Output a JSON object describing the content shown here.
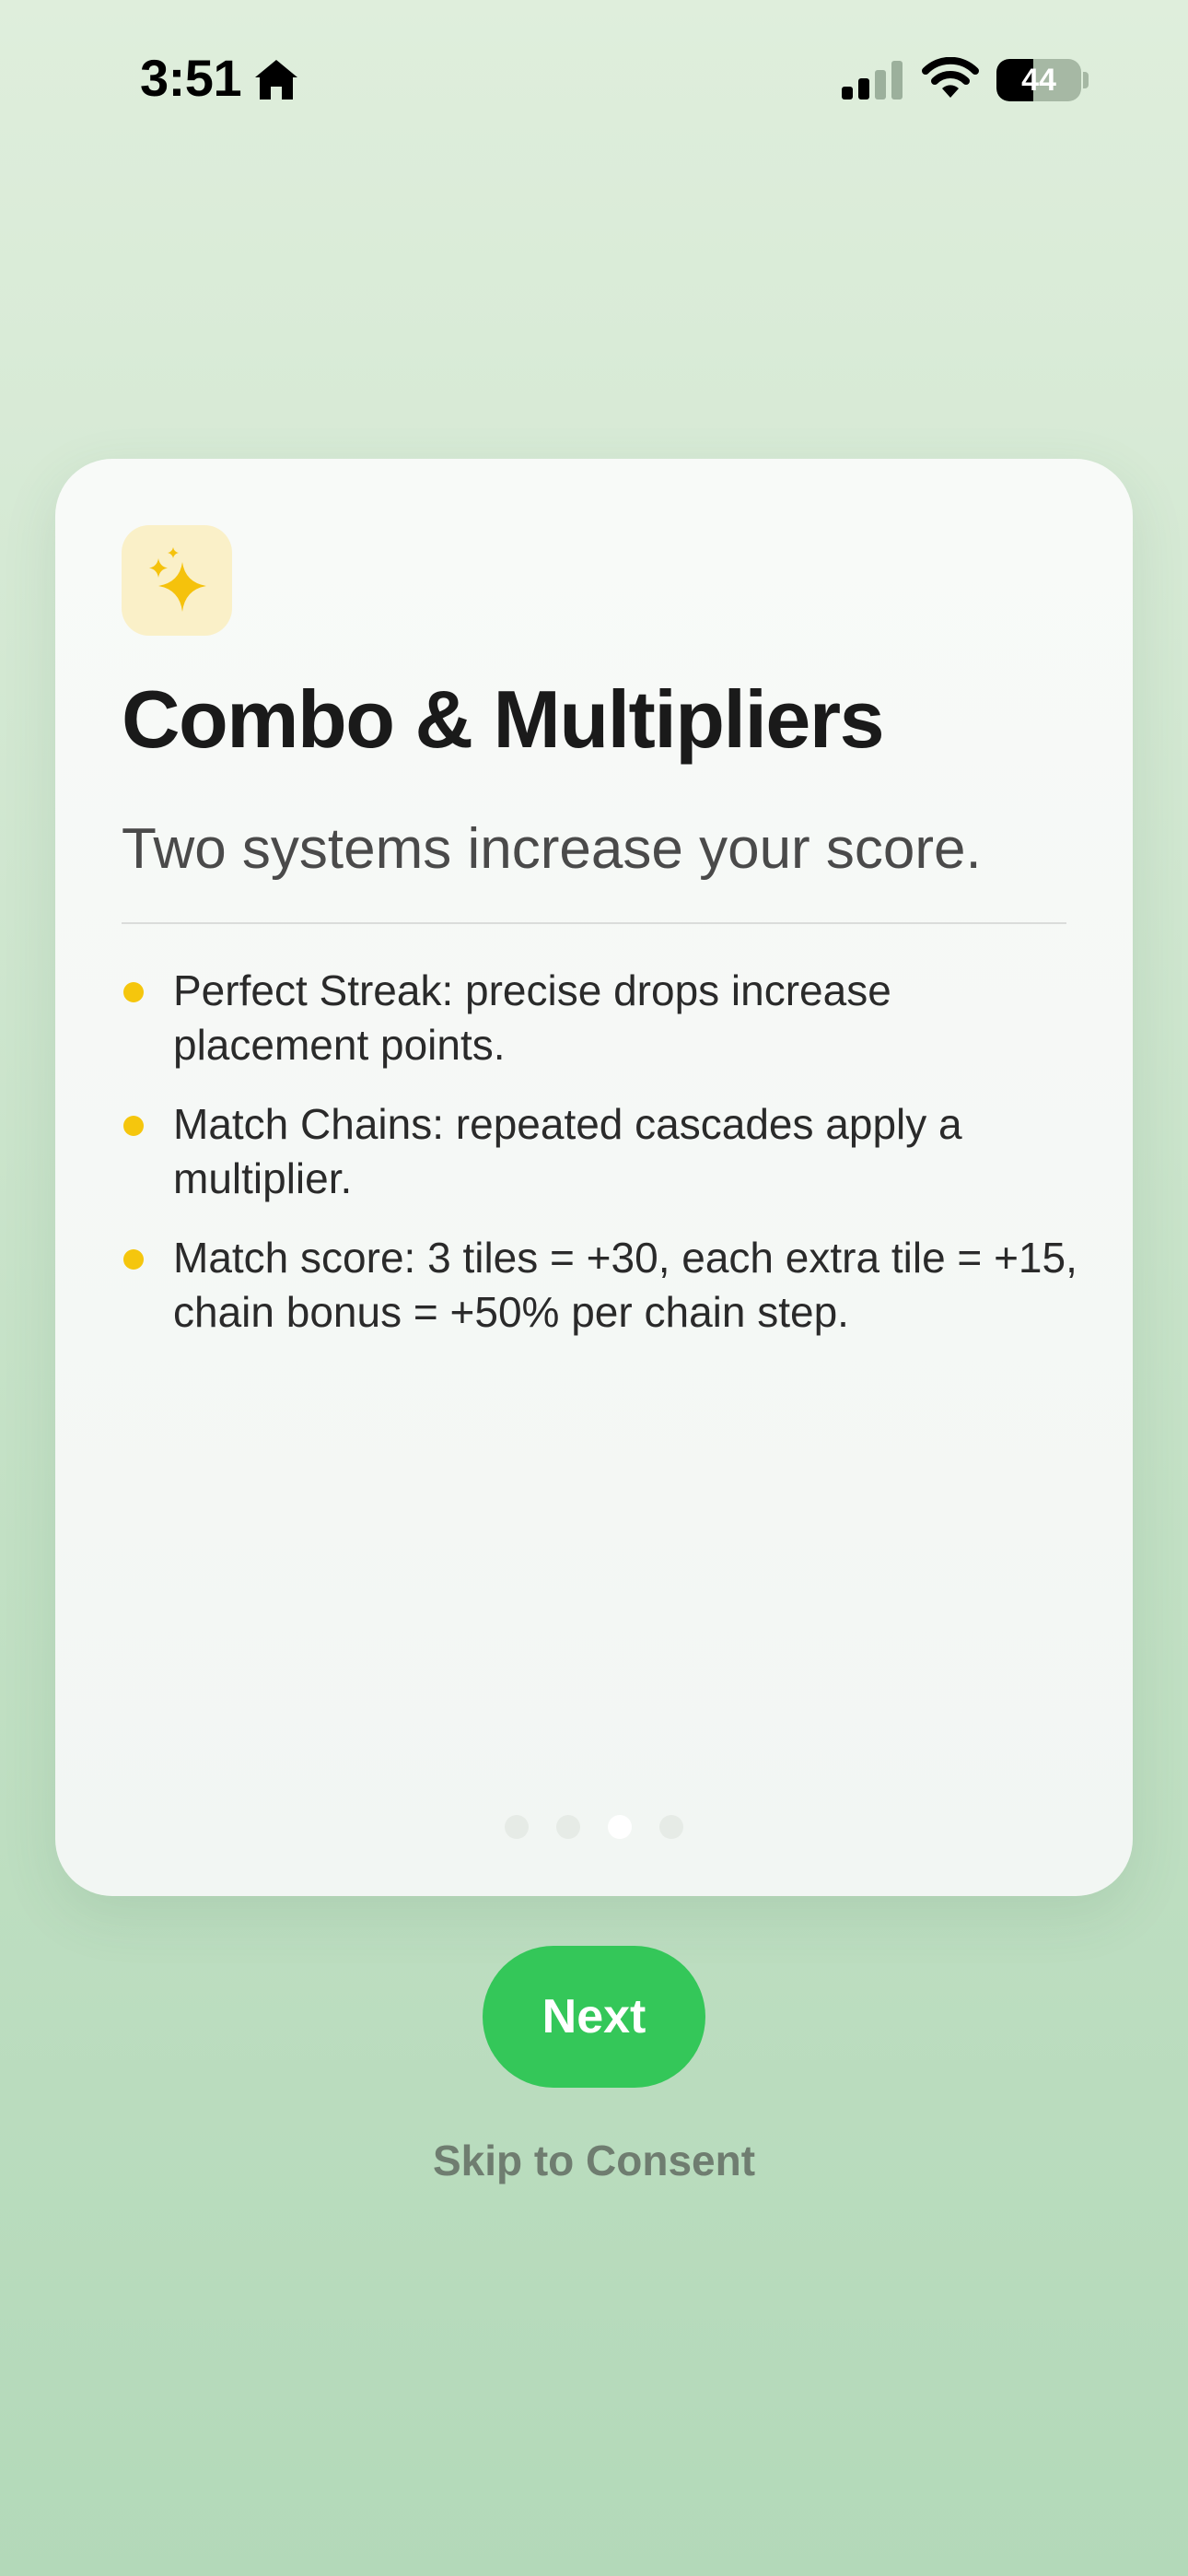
{
  "status_bar": {
    "time": "3:51",
    "battery_level": "44",
    "icons": [
      "home-icon",
      "cellular-signal-icon",
      "wifi-icon",
      "battery-icon"
    ]
  },
  "card": {
    "icon": "sparkles-icon",
    "title": "Combo & Multipliers",
    "subtitle": "Two systems increase your score.",
    "bullets": [
      "Perfect Streak: precise drops increase placement points.",
      "Match Chains: repeated cascades apply a multiplier.",
      "Match score: 3 tiles = +30, each extra tile = +15, chain bonus = +50% per chain step."
    ],
    "pagination": {
      "total": 4,
      "current": 3
    }
  },
  "actions": {
    "next_label": "Next",
    "skip_label": "Skip to Consent"
  },
  "colors": {
    "accent": "#34c759",
    "bullet": "#f5c60d",
    "icon_tile": "#faf0c8"
  }
}
